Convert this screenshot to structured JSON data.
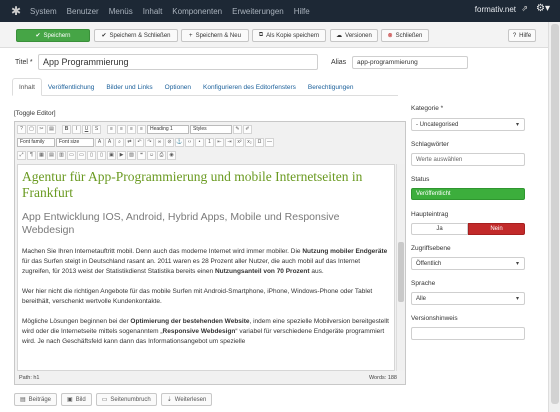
{
  "topbar": {
    "menu": [
      "System",
      "Benutzer",
      "Menüs",
      "Inhalt",
      "Komponenten",
      "Erweiterungen",
      "Hilfe"
    ],
    "site": "formativ.net"
  },
  "toolbar": {
    "save": "Speichern",
    "save_close": "Speichern & Schließen",
    "save_new": "Speichern & Neu",
    "save_copy": "Als Kopie speichern",
    "versions": "Versionen",
    "close": "Schließen",
    "help": "Hilfe"
  },
  "form": {
    "title_label": "Titel *",
    "title_value": "App Programmierung",
    "alias_label": "Alias",
    "alias_value": "app-programmierung"
  },
  "tabs": [
    "Inhalt",
    "Veröffentlichung",
    "Bilder und Links",
    "Optionen",
    "Konfigurieren des Editorfensters",
    "Berechtigungen"
  ],
  "editor": {
    "toggle": "[Toggle Editor]",
    "heading_select": "Heading 1",
    "styles_select": "Styles",
    "font_family": "Font family",
    "font_size": "Font size",
    "h1": "Agentur für App-Programmierung und mobile Internetseiten in Frankfurt",
    "h2": "App Entwicklung IOS, Android, Hybrid Apps, Mobile und Responsive Webdesign",
    "p1_a": "Machen Sie Ihren Internetauftritt mobil. Denn auch das moderne Internet wird immer mobiler. Die ",
    "p1_b": "Nutzung mobiler Endgeräte",
    "p1_c": " für das Surfen steigt in Deutschland rasant an. 2011 waren es 28 Prozent aller Nutzer, die auch mobil auf das Internet zugreifen, für 2013 weist der Statistikdienst Statistika bereits einen ",
    "p1_d": "Nutzungsanteil von 70 Prozent",
    "p1_e": " aus.",
    "p2": "Wer hier nicht die richtigen Angebote für das mobile Surfen mit Android-Smartphone, iPhone, Windows-Phone oder Tablet bereithält, verschenkt wertvolle Kundenkontakte.",
    "p3_a": "Mögliche Lösungen beginnen bei der ",
    "p3_b": "Optimierung der bestehenden Website",
    "p3_c": ", indem eine spezielle Mobilversion bereitgestellt wird oder die Internetseite mittels sogenanntem „",
    "p3_d": "Responsive Webdesign",
    "p3_e": "“ variabel für verschiedene Endgeräte programmiert wird. Je nach Geschäftsfeld kann dann das Informationsangebot um spezielle",
    "path": "Path: h1",
    "words": "Words: 188"
  },
  "bottom_buttons": [
    "Beiträge",
    "Bild",
    "Seitenumbruch",
    "Weiterlesen"
  ],
  "sidebar": {
    "kategorie_label": "Kategorie *",
    "kategorie_value": "- Uncategorised",
    "schlagwoerter_label": "Schlagwörter",
    "schlagwoerter_placeholder": "Werte auswählen",
    "status_label": "Status",
    "status_value": "Veröffentlicht",
    "haupteintrag_label": "Haupteintrag",
    "ja": "Ja",
    "nein": "Nein",
    "zugriff_label": "Zugriffsebene",
    "zugriff_value": "Öffentlich",
    "sprache_label": "Sprache",
    "sprache_value": "Alle",
    "versionshinweis_label": "Versionshinweis"
  },
  "colors": {
    "topbar": "#1d2835",
    "save_green": "#46a546",
    "status_green": "#3cae3c",
    "nein_red": "#c22a2a",
    "h1_green": "#6a9a21",
    "link_blue": "#1a5f9a"
  }
}
